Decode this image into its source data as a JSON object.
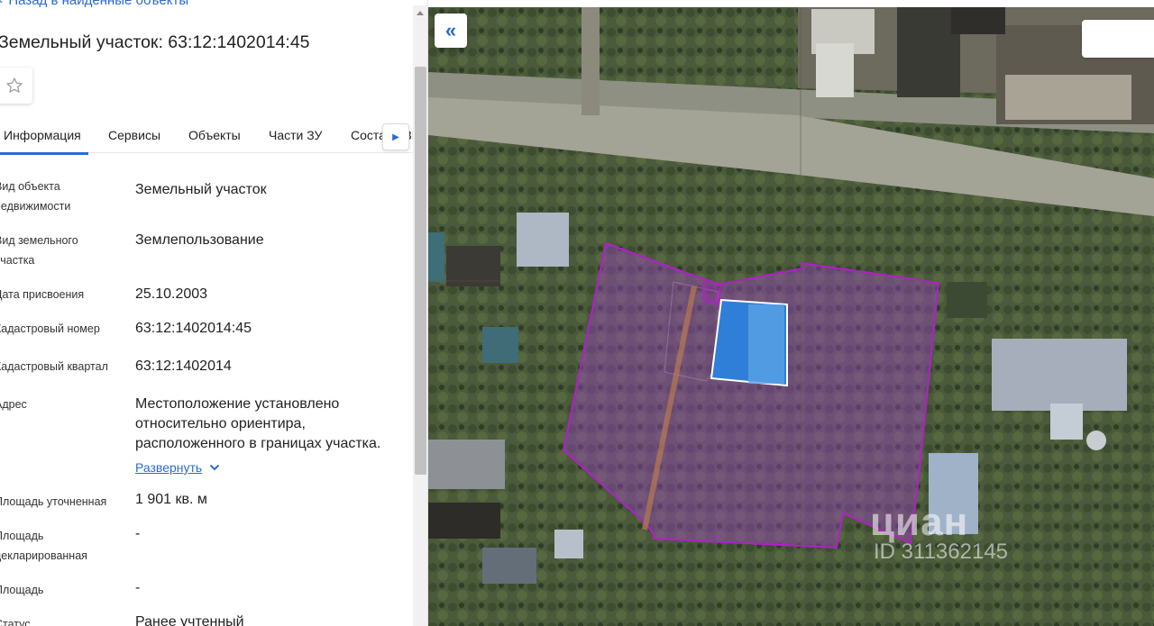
{
  "panel": {
    "back_label": "Назад в найденные объекты",
    "title": "Земельный участок: 63:12:1402014:45",
    "tabs": [
      "Информация",
      "Сервисы",
      "Объекты",
      "Части ЗУ",
      "Состав ЕЗП"
    ],
    "active_tab": "Информация",
    "rows": [
      {
        "label": "Вид объекта недвижимости",
        "value": "Земельный участок"
      },
      {
        "label": "Вид земельного участка",
        "value": "Землепользование"
      },
      {
        "label": "Дата присвоения",
        "value": "25.10.2003"
      },
      {
        "label": "Кадастровый номер",
        "value": "63:12:1402014:45"
      },
      {
        "label": "Кадастровый квартал",
        "value": "63:12:1402014"
      },
      {
        "label": "Адрес",
        "value": "Местоположение установлено относительно ориентира, расположенного в границах участка."
      },
      {
        "label": "Площадь уточненная",
        "value": "1 901 кв. м"
      },
      {
        "label": "Площадь декларированная",
        "value": "-"
      },
      {
        "label": "Площадь",
        "value": "-"
      },
      {
        "label": "Статус",
        "value": "Ранее учтенный"
      }
    ],
    "expand_label": "Развернуть"
  },
  "map": {
    "parcel_color": "#b020c8",
    "watermark_brand": "циан",
    "watermark_id": "ID 311362145"
  },
  "icons": {
    "back": "chevron-left-icon",
    "favorite": "star-icon",
    "tabs_next": "caret-right-icon",
    "collapse": "double-chevron-left-icon",
    "expand": "chevron-down-icon"
  }
}
